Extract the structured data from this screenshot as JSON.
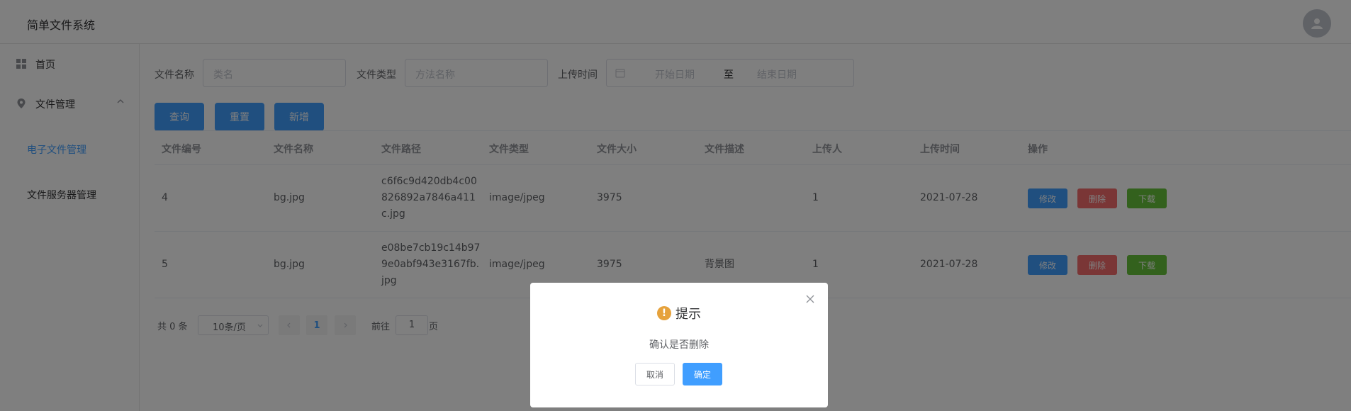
{
  "header": {
    "title": "简单文件系统"
  },
  "sidebar": {
    "items": [
      {
        "label": "首页"
      },
      {
        "label": "文件管理"
      }
    ],
    "subitems": [
      {
        "label": "电子文件管理"
      },
      {
        "label": "文件服务器管理"
      }
    ]
  },
  "filters": {
    "name_label": "文件名称",
    "name_placeholder": "类名",
    "type_label": "文件类型",
    "type_placeholder": "方法名称",
    "time_label": "上传时间",
    "start_placeholder": "开始日期",
    "range_sep": "至",
    "end_placeholder": "结束日期"
  },
  "toolbar": {
    "query": "查询",
    "reset": "重置",
    "add": "新增"
  },
  "table": {
    "headers": [
      "文件编号",
      "文件名称",
      "文件路径",
      "文件类型",
      "文件大小",
      "文件描述",
      "上传人",
      "上传时间",
      "操作"
    ],
    "rows": [
      {
        "id": "4",
        "name": "bg.jpg",
        "path1": "c6f6c9d420db4c00",
        "path2": "826892a7846a411",
        "path3": "c.jpg",
        "type": "image/jpeg",
        "size": "3975",
        "desc": "",
        "uploader": "1",
        "time": "2021-07-28"
      },
      {
        "id": "5",
        "name": "bg.jpg",
        "path1": "e08be7cb19c14b97",
        "path2": "9e0abf943e3167fb.",
        "path3": "jpg",
        "type": "image/jpeg",
        "size": "3975",
        "desc": "背景图",
        "uploader": "1",
        "time": "2021-07-28"
      }
    ],
    "ops": {
      "edit": "修改",
      "delete": "删除",
      "download": "下载"
    }
  },
  "pagination": {
    "total": "共 0 条",
    "page_size": "10条/页",
    "current": "1",
    "goto_label": "前往",
    "goto_value": "1",
    "page_unit": "页"
  },
  "dialog": {
    "title": "提示",
    "message": "确认是否删除",
    "cancel": "取消",
    "confirm": "确定"
  },
  "colors": {
    "primary": "#409eff",
    "danger": "#f56c6c",
    "success": "#67c23a",
    "warning": "#e6a23c"
  }
}
